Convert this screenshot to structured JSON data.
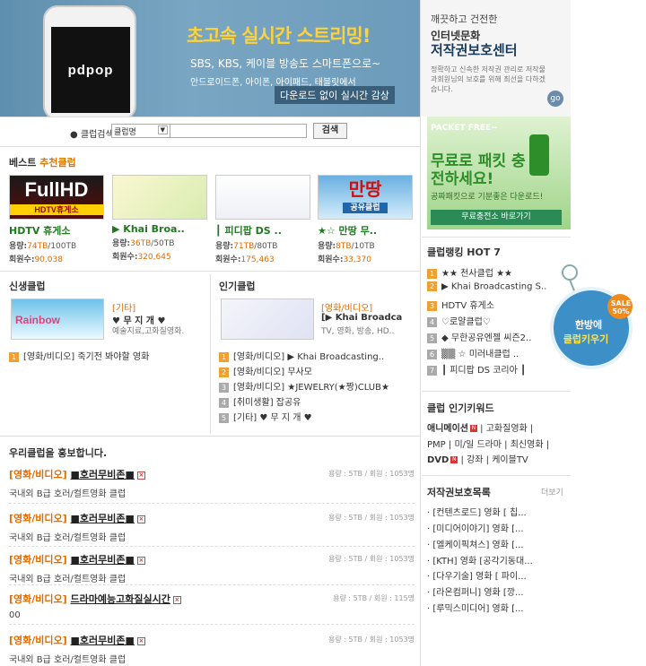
{
  "banner": {
    "url": "m.pdpop.com",
    "headline": "초고속 실시간 스트리밍!",
    "subline": "SBS, KBS, 케이블  방송도 스마트폰으로~",
    "devices": "안드로이드폰, 아이폰, 아이패드, 태블릿에서",
    "cta": "다운로드 없이 실시간 감상",
    "logo": "pdpop"
  },
  "copyright_promo": {
    "line1": "깨끗하고 건전한",
    "line2": "인터넷문화",
    "line3": "저작권보호센터",
    "desc": "정확하고 신속한 저작권 관리로 저작물과회원님의 보호를 위해 최선을 다하겠습니다.",
    "go": "go"
  },
  "search": {
    "label": "클럽검색",
    "select_value": "클럽명",
    "button": "검색"
  },
  "best": {
    "title_prefix": "베스트",
    "title_highlight": "추천클럽",
    "clubs": [
      {
        "name": "HDTV 휴게소",
        "usage_label": "용량:",
        "usage_used": "74TB",
        "usage_total": "/100TB",
        "members_label": "회원수:",
        "members": "90,038",
        "thumb_text": "FullHD",
        "thumb_sub": "HDTV휴게소"
      },
      {
        "name": "▶ Khai Broa..",
        "usage_label": "용량:",
        "usage_used": "36TB",
        "usage_total": "/50TB",
        "members_label": "회원수:",
        "members": "320,645",
        "thumb_text": "",
        "thumb_sub": ""
      },
      {
        "name": "┃ 피디팝 DS ..",
        "usage_label": "용량:",
        "usage_used": "71TB",
        "usage_total": "/80TB",
        "members_label": "회원수:",
        "members": "175,463",
        "thumb_text": "",
        "thumb_sub": ""
      },
      {
        "name": "★☆ 만땅 무..",
        "usage_label": "용량:",
        "usage_used": "8TB",
        "usage_total": "/10TB",
        "members_label": "회원수:",
        "members": "33,370",
        "thumb_text": "만땅",
        "thumb_sub": "공유클럽"
      }
    ]
  },
  "new_clubs": {
    "title": "신생클럽",
    "featured": {
      "category": "[기타]",
      "name": "♥ 무 지 개 ♥",
      "desc": "예술지료,고화질영화.",
      "thumb_text": "Rainbow"
    },
    "list": [
      {
        "rank": "1",
        "text": "[영화/비디오] 죽기전 봐야할 영화"
      }
    ]
  },
  "popular_clubs": {
    "title": "인기클럽",
    "featured": {
      "category": "[영화/비디오]",
      "name": "[▶ Khai Broadca",
      "desc": "TV, 영화, 방송, HD.."
    },
    "list": [
      {
        "rank": "1",
        "text": "[영화/비디오] ▶ Khai Broadcasting.."
      },
      {
        "rank": "2",
        "text": "[영화/비디오] 무사모"
      },
      {
        "rank": "3",
        "text": "[영화/비디오] ★JEWELRY(★짱)CLUB★"
      },
      {
        "rank": "4",
        "text": "[취미생활] 잡공유"
      },
      {
        "rank": "5",
        "text": "[기타] ♥ 무 지 개 ♥"
      }
    ]
  },
  "promo": {
    "title": "우리클럽을 홍보합니다.",
    "items": [
      {
        "category": "[영화/비디오]",
        "name": "■호러무비존■",
        "meta": "용량 : 5TB / 회원 : 1053명",
        "desc": "국내외 B급 호러/컬트영화 클럽"
      },
      {
        "category": "[영화/비디오]",
        "name": "■호러무비존■",
        "meta": "용량 : 5TB / 회원 : 1053명",
        "desc": "국내외 B급 호러/컬트영화 클럽"
      },
      {
        "category": "[영화/비디오]",
        "name": "■호러무비존■",
        "meta": "용량 : 5TB / 회원 : 1053명",
        "desc": "국내외 B급 호러/컬트영화 클럽"
      },
      {
        "category": "[영화/비디오]",
        "name": "드라마예능고화질실시간",
        "meta": "용량 : 5TB / 회원 : 115명",
        "desc": "00"
      },
      {
        "category": "[영화/비디오]",
        "name": "■호러무비존■",
        "meta": "용량 : 5TB / 회원 : 1053명",
        "desc": "국내외 B급 호러/컬트영화 클럽"
      }
    ]
  },
  "packet_ad": {
    "head": "PACKET FREE~",
    "title": "무료로 패킷 충전하세요!",
    "sub": "공짜패킷으로 기분좋은 다운로드!",
    "button": "무료충전소 바로가기"
  },
  "hot7": {
    "title": "클럽랭킹 HOT 7",
    "items": [
      {
        "rank": "1",
        "text": "★★ 천사클럽 ★★"
      },
      {
        "rank": "2",
        "text": "▶ Khai Broadcasting S.."
      },
      {
        "rank": "3",
        "text": "HDTV 휴게소"
      },
      {
        "rank": "4",
        "text": "♡로얄클럽♡"
      },
      {
        "rank": "5",
        "text": "◆ 무한공유엔젤 씨즌2.."
      },
      {
        "rank": "6",
        "text": "▒▒ ☆ 미러내클럽 .."
      },
      {
        "rank": "7",
        "text": "┃ 피디팝 DS 코리아 ┃"
      }
    ]
  },
  "sale_tag": {
    "line1": "한방에",
    "line2": "클럽키우기",
    "badge": "SALE 50%"
  },
  "keywords": {
    "title": "클럽 인기키워드",
    "rows": [
      [
        {
          "text": "애니메이션",
          "hot": true,
          "new": true
        },
        {
          "text": "고화질영화",
          "hot": false,
          "new": false
        }
      ],
      [
        {
          "text": "PMP",
          "hot": false,
          "new": false
        },
        {
          "text": "미/일 드라마",
          "hot": false,
          "new": false
        },
        {
          "text": "최신영화",
          "hot": false,
          "new": false
        }
      ],
      [
        {
          "text": "DVD",
          "hot": true,
          "new": true
        },
        {
          "text": "강좌",
          "hot": false,
          "new": false
        },
        {
          "text": "케이블TV",
          "hot": false,
          "new": false
        }
      ]
    ]
  },
  "rights": {
    "title": "저작권보호목록",
    "more": "더보기",
    "items": [
      "[컨텐츠로드] 영화 [ 칩...",
      "[미디어이야기] 영화 [...",
      "[엘케이픽쳐스] 영화 [...",
      "[KTH] 영화 [공각기동대...",
      "[다우기술] 영화 [ 파이...",
      "[라온컴퍼니] 영화 [깡...",
      "[루믹스미디어] 영화 [..."
    ]
  }
}
